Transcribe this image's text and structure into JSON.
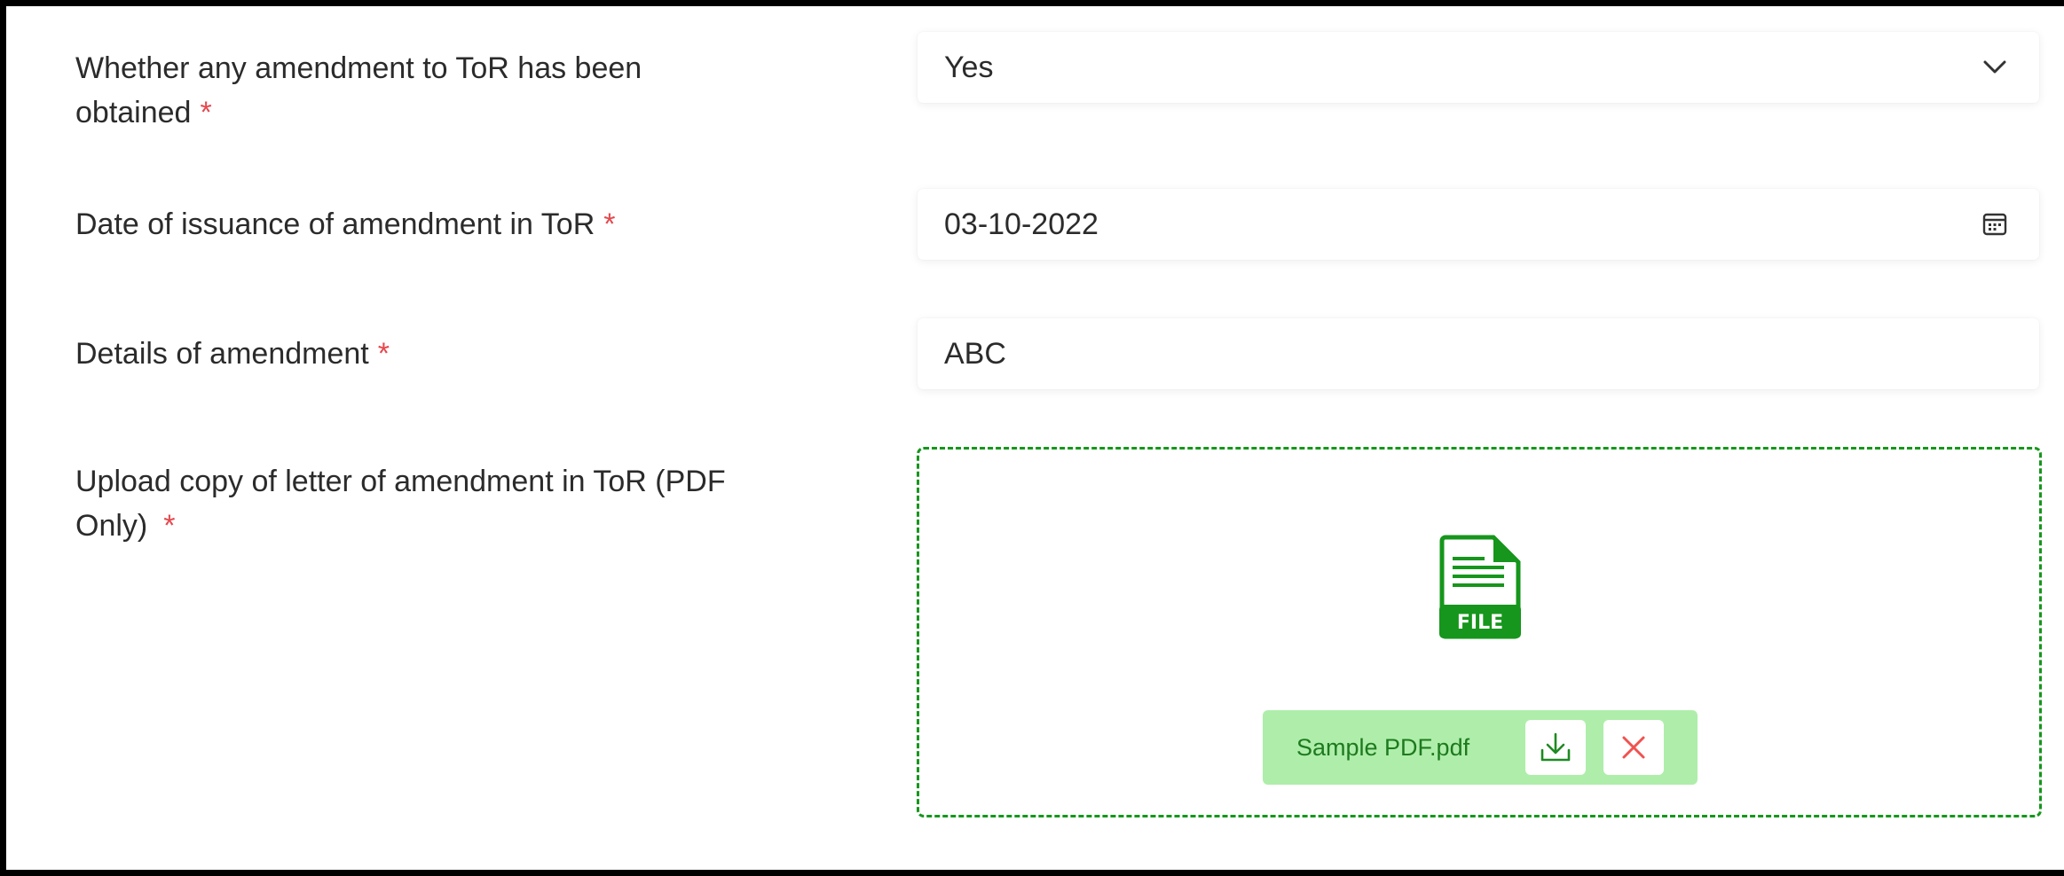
{
  "form": {
    "amendment_obtained": {
      "label": "Whether any amendment to ToR has been",
      "label_line2": "obtained",
      "required_marker": "*",
      "value": "Yes",
      "icon": "chevron-down-icon"
    },
    "issuance_date": {
      "label": "Date of issuance of amendment in ToR",
      "required_marker": "*",
      "value": "03-10-2022",
      "icon": "calendar-icon"
    },
    "amendment_details": {
      "label": "Details of amendment",
      "required_marker": "*",
      "value": "ABC"
    },
    "upload_letter": {
      "label": "Upload copy of letter of amendment in ToR (PDF",
      "label_line2": "Only)",
      "required_marker": "*",
      "file_icon_text": "FILE",
      "file_name": "Sample PDF.pdf",
      "download_icon": "download-icon",
      "remove_icon": "close-icon"
    }
  },
  "colors": {
    "required": "#e5484d",
    "accent_green": "#16961c",
    "chip_background": "#aeeeaa",
    "remove_red": "#ef5350"
  }
}
